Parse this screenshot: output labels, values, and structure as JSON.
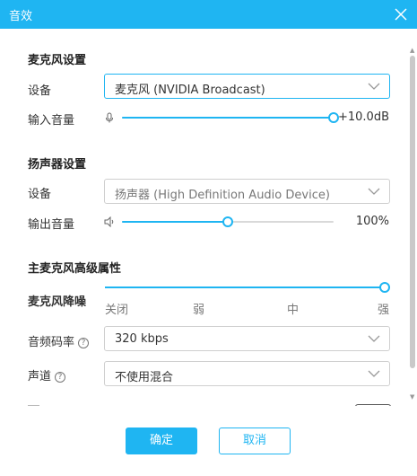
{
  "window": {
    "title": "音效",
    "close_icon": "close-icon"
  },
  "colors": {
    "accent": "#1fb5f2",
    "track": "#d9d9d9",
    "title_bg": "#1fb5f2"
  },
  "mic_settings": {
    "title": "麦克风设置",
    "device_label": "设备",
    "device_value": "麦克风 (NVIDIA Broadcast)",
    "volume_label": "输入音量",
    "volume_icon": "microphone-icon",
    "volume_value_text": "+10.0dB",
    "volume_fraction": 1.0
  },
  "speaker_settings": {
    "title": "扬声器设置",
    "device_label": "设备",
    "device_value": "扬声器 (High Definition Audio Device)",
    "volume_label": "输出音量",
    "volume_icon": "speaker-icon",
    "volume_value_text": "100%",
    "volume_fraction": 0.5
  },
  "advanced": {
    "title": "主麦克风高级属性",
    "noise_label": "麦克风降噪",
    "noise_levels": [
      "关闭",
      "弱",
      "中",
      "强"
    ],
    "noise_selected_index": 3,
    "bitrate_label": "音频码率",
    "bitrate_value": "320 kbps",
    "channel_label": "声道",
    "channel_value": "不使用混合",
    "help_icon": "?"
  },
  "buttons": {
    "confirm": "确定",
    "cancel": "取消"
  }
}
